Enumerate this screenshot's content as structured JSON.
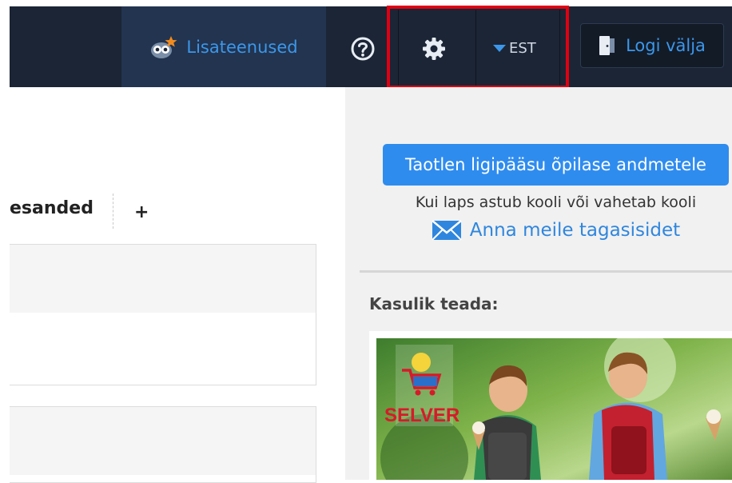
{
  "header": {
    "extra_services": {
      "label": "Lisateenused",
      "icon": "owl-icon"
    },
    "help": {
      "icon": "help-circle-icon"
    },
    "settings": {
      "icon": "gear-icon"
    },
    "language": {
      "label": "EST",
      "icon": "caret-down-icon"
    },
    "logout": {
      "label": "Logi välja",
      "icon": "door-exit-icon"
    }
  },
  "tabs": {
    "partial_label": "esanded",
    "add_label": "+"
  },
  "sidebar": {
    "request_access_label": "Taotlen ligipääsu õpilase andmetele",
    "request_access_hint": "Kui laps astub kooli või vahetab kooli",
    "feedback": {
      "label": "Anna meile tagasisidet",
      "icon": "envelope-icon"
    },
    "useful_title": "Kasulik teada:",
    "promo": {
      "brand_text": "SELVER"
    }
  },
  "colors": {
    "topbar": "#1b2535",
    "accent": "#3c97ea",
    "cta": "#2f8cef",
    "highlight": "#e00012"
  }
}
